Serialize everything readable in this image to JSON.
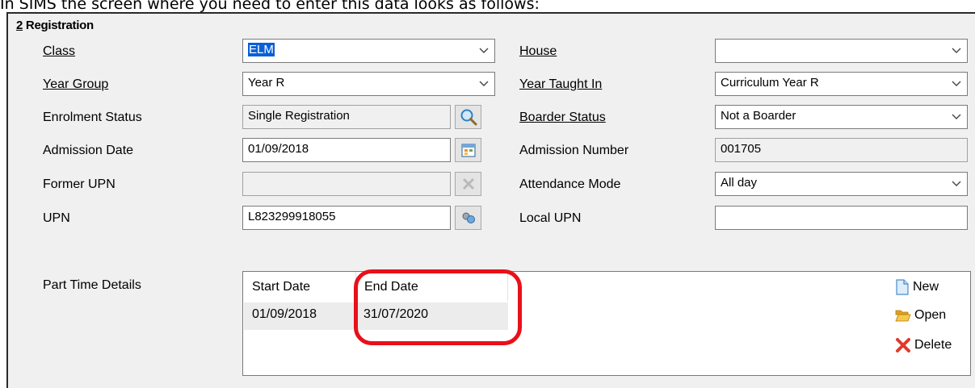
{
  "caption": "In SIMS the screen where you need to enter this data looks as follows:",
  "section": {
    "number": "2",
    "title": " Registration"
  },
  "left_fields": [
    {
      "label": "Class",
      "value": "ELM",
      "kind": "combo"
    },
    {
      "label": "Year Group",
      "value": "Year  R",
      "kind": "combo"
    },
    {
      "label": "Enrolment Status",
      "value": "Single Registration",
      "kind": "readonly",
      "button_icon": "search-icon"
    },
    {
      "label": "Admission Date",
      "value": "01/09/2018",
      "kind": "text",
      "button_icon": "calendar-icon"
    },
    {
      "label": "Former UPN",
      "value": "",
      "kind": "readonly",
      "button_icon": "clear-icon"
    },
    {
      "label": "UPN",
      "value": "L823299918055",
      "kind": "text",
      "button_icon": "generate-upn-icon"
    }
  ],
  "right_fields": [
    {
      "label": "House",
      "value": "",
      "kind": "combo"
    },
    {
      "label": "Year Taught In",
      "value": "Curriculum Year  R",
      "kind": "combo"
    },
    {
      "label": "Boarder Status",
      "value": "Not a Boarder",
      "kind": "combo"
    },
    {
      "label": "Admission Number",
      "value": "001705",
      "kind": "readonly"
    },
    {
      "label": "Attendance Mode",
      "value": "All day",
      "kind": "combo"
    },
    {
      "label": "Local UPN",
      "value": "",
      "kind": "text"
    }
  ],
  "part_time": {
    "label": "Part Time Details",
    "columns": [
      "Start Date",
      "End Date"
    ],
    "rows": [
      [
        "01/09/2018",
        "31/07/2020"
      ]
    ],
    "actions": [
      {
        "label": "New",
        "icon": "new-document-icon"
      },
      {
        "label": "Open",
        "icon": "folder-open-icon"
      },
      {
        "label": "Delete",
        "icon": "delete-x-icon"
      }
    ]
  },
  "colors": {
    "highlight": "#e8101a",
    "selection": "#0a5fd6",
    "panel": "#f0f0f0"
  }
}
